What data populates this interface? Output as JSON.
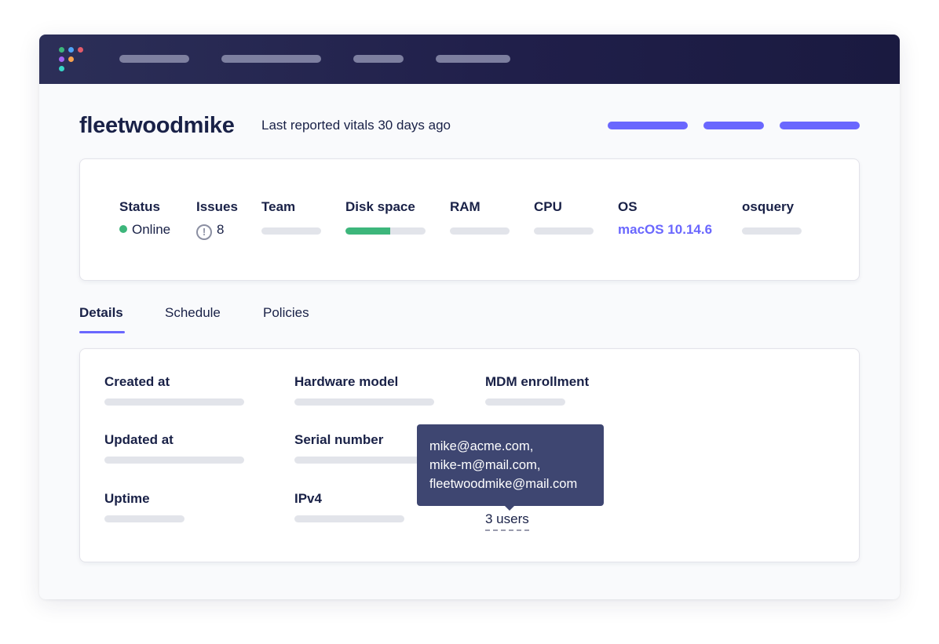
{
  "host": {
    "name": "fleetwoodmike",
    "last_reported": "Last reported vitals 30 days ago"
  },
  "vitals": {
    "status": {
      "label": "Status",
      "value": "Online",
      "color": "#3db67b"
    },
    "issues": {
      "label": "Issues",
      "icon": "!",
      "count": "8"
    },
    "team": {
      "label": "Team"
    },
    "disk_space": {
      "label": "Disk space",
      "used_fraction": 0.56,
      "color": "#3db67b"
    },
    "ram": {
      "label": "RAM"
    },
    "cpu": {
      "label": "CPU"
    },
    "os": {
      "label": "OS",
      "value": "macOS 10.14.6"
    },
    "osquery": {
      "label": "osquery"
    }
  },
  "tabs": [
    {
      "label": "Details",
      "active": true
    },
    {
      "label": "Schedule",
      "active": false
    },
    {
      "label": "Policies",
      "active": false
    }
  ],
  "details": {
    "created_at": "Created at",
    "updated_at": "Updated at",
    "uptime": "Uptime",
    "hardware_model": "Hardware model",
    "serial_number": "Serial number",
    "ipv4": "IPv4",
    "mdm_enrollment": "MDM enrollment",
    "users_link": "3 users"
  },
  "tooltip": {
    "lines": [
      "mike@acme.com,",
      "mike-m@mail.com,",
      "fleetwoodmike@mail.com"
    ]
  },
  "colors": {
    "accent": "#6a67fe",
    "navbar": "#201f4a",
    "text": "#192147",
    "tooltip_bg": "#3e4671",
    "online": "#3db67b"
  },
  "icons": {
    "logo": "fleet-logo-icon",
    "issues": "alert-circle-icon",
    "status": "status-dot-icon"
  }
}
